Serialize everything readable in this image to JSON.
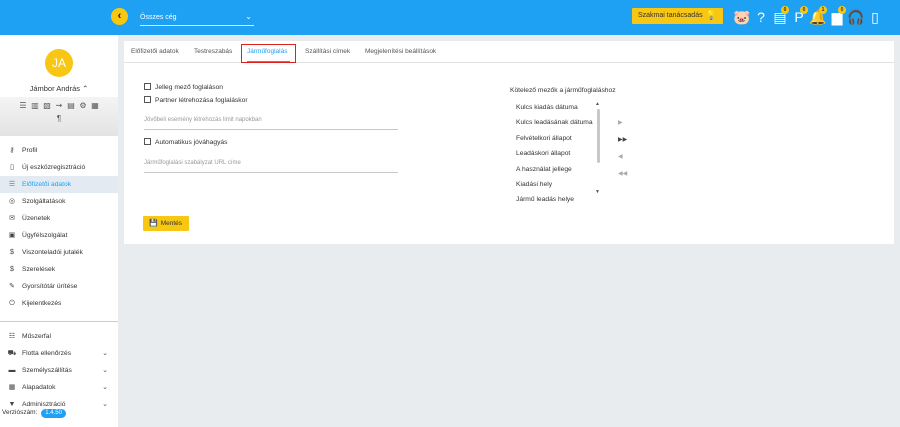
{
  "header": {
    "company_select": "Összes cég",
    "advisor_button": "Szakmai tanácsadás",
    "icons": [
      {
        "name": "piggy-bank-icon",
        "glyph": "🐷",
        "badge": ""
      },
      {
        "name": "help-icon",
        "glyph": "?",
        "badge": ""
      },
      {
        "name": "document-icon",
        "glyph": "▤",
        "badge": "0"
      },
      {
        "name": "parking-icon",
        "glyph": "P",
        "badge": "0"
      },
      {
        "name": "bell-icon",
        "glyph": "🔔",
        "badge": "1"
      },
      {
        "name": "chat-icon",
        "glyph": "▆",
        "badge": "0"
      },
      {
        "name": "headset-icon",
        "glyph": "🎧",
        "badge": ""
      },
      {
        "name": "phone-download-icon",
        "glyph": "▯",
        "badge": ""
      }
    ]
  },
  "user": {
    "initials": "JA",
    "name": "Jámbor András",
    "toggle": "^"
  },
  "sidebar": {
    "items": [
      {
        "label": "Profil",
        "icon": "user-key-icon",
        "glyph": "⚷",
        "active": false
      },
      {
        "label": "Új eszközregisztráció",
        "icon": "device-icon",
        "glyph": "▯",
        "active": false
      },
      {
        "label": "Előfizetői adatok",
        "icon": "list-icon",
        "glyph": "☰",
        "active": true
      },
      {
        "label": "Szolgáltatások",
        "icon": "services-icon",
        "glyph": "◎",
        "active": false
      },
      {
        "label": "Üzenetek",
        "icon": "messages-icon",
        "glyph": "✉",
        "active": false
      },
      {
        "label": "Ügyfélszolgálat",
        "icon": "support-icon",
        "glyph": "▣",
        "active": false
      },
      {
        "label": "Viszonteladói jutalék",
        "icon": "dollar-icon",
        "glyph": "$",
        "active": false
      },
      {
        "label": "Szerelések",
        "icon": "dollar-icon",
        "glyph": "$",
        "active": false
      },
      {
        "label": "Gyorsítótár ürítése",
        "icon": "brush-icon",
        "glyph": "✎",
        "active": false
      },
      {
        "label": "Kijelentkezés",
        "icon": "logout-icon",
        "glyph": "⏻",
        "active": false
      }
    ],
    "items2": [
      {
        "label": "Műszerfal",
        "icon": "dashboard-icon",
        "glyph": "☷",
        "chevron": false
      },
      {
        "label": "Flotta ellenőrzés",
        "icon": "car-icon",
        "glyph": "⛟",
        "chevron": true
      },
      {
        "label": "Személyszállítás",
        "icon": "bus-icon",
        "glyph": "▬",
        "chevron": true
      },
      {
        "label": "Alapadatok",
        "icon": "data-icon",
        "glyph": "▦",
        "chevron": true
      },
      {
        "label": "Adminisztráció",
        "icon": "admin-icon",
        "glyph": "▼",
        "chevron": true
      }
    ],
    "version_label": "Verziószám:",
    "version": "1.4.50"
  },
  "tabs": [
    {
      "label": "Előfizetői adatok",
      "active": false
    },
    {
      "label": "Testreszabás",
      "active": false
    },
    {
      "label": "Járműfoglalás",
      "active": true
    },
    {
      "label": "Szállítási címek",
      "active": false
    },
    {
      "label": "Megjelenítési beállítások",
      "active": false
    }
  ],
  "form": {
    "jelleg_checkbox": "Jelleg mező foglaláson",
    "partner_checkbox": "Partner létrehozása foglaláskor",
    "future_event_placeholder": "Jövőbeli esemény létrehozás limit napokban",
    "auto_approve_checkbox": "Automatikus jóváhagyás",
    "policy_url_placeholder": "Járműfoglalási szabályzat URL címe",
    "required_fields_title": "Kötelező mezők a járműfoglaláshoz",
    "required_fields": [
      "Kulcs kiadás dátuma",
      "Kulcs leadásának dátuma",
      "Felvételkori állapot",
      "Leadáskori állapot",
      "A használat jellege",
      "Kiadási hely",
      "Jármű leadás helye"
    ],
    "save_button": "Mentés"
  },
  "colors": {
    "accent": "#1ea1f2",
    "yellow": "#f7c713",
    "highlight": "#e0201b"
  }
}
